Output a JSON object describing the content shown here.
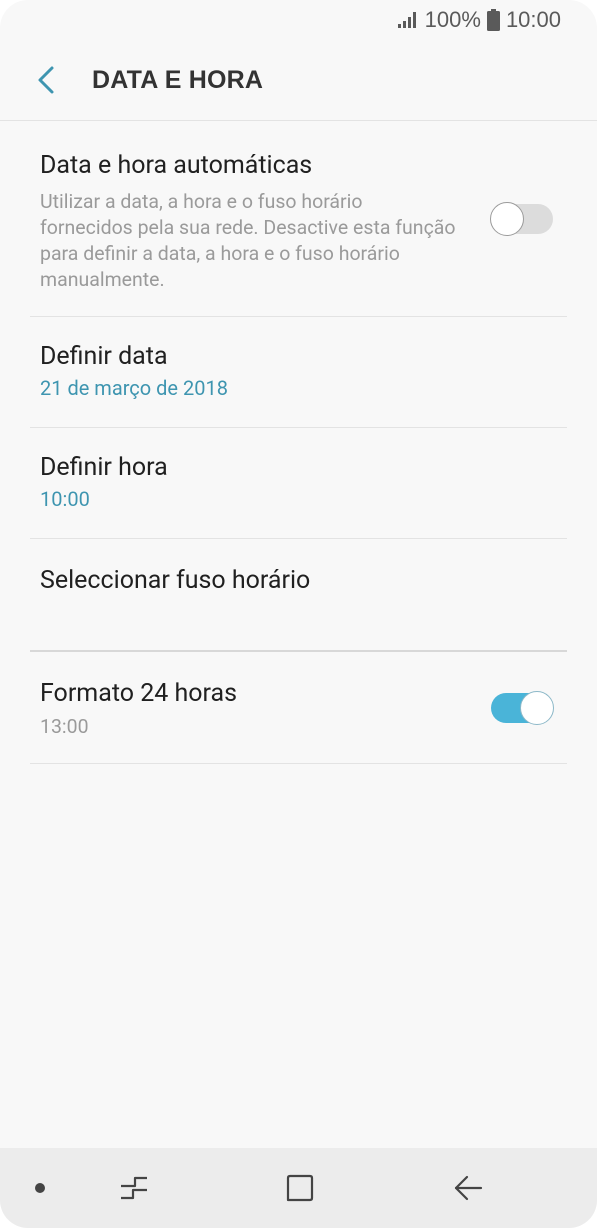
{
  "status_bar": {
    "battery_text": "100%",
    "time": "10:00"
  },
  "header": {
    "title": "DATA E HORA"
  },
  "settings": {
    "auto": {
      "title": "Data e hora automáticas",
      "description": "Utilizar a data, a hora e o fuso horário fornecidos pela sua rede. Desactive esta função para definir a data, a hora e o fuso horário manualmente.",
      "enabled": false
    },
    "set_date": {
      "title": "Definir data",
      "value": "21 de março de 2018"
    },
    "set_time": {
      "title": "Definir hora",
      "value": "10:00"
    },
    "timezone": {
      "title": "Seleccionar fuso horário"
    },
    "format24": {
      "title": "Formato 24 horas",
      "value": "13:00",
      "enabled": true
    }
  },
  "colors": {
    "accent": "#3e95b0",
    "toggle_on": "#4ab4d8",
    "toggle_off": "#dcdcdc"
  }
}
